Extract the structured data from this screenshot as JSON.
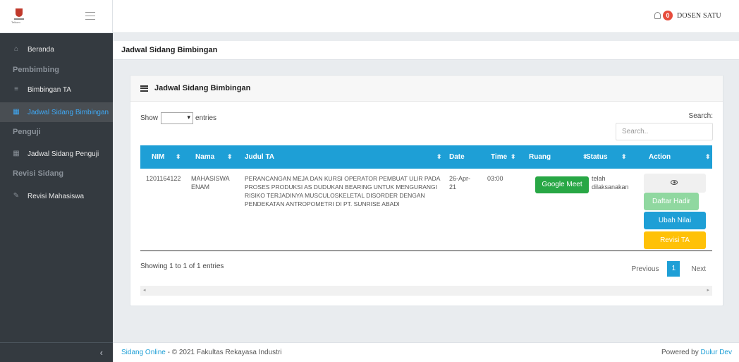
{
  "brand": {
    "logo_text": "Telkom"
  },
  "topbar": {
    "notification_count": "0",
    "user": "DOSEN SATU"
  },
  "sidebar": {
    "beranda": "Beranda",
    "header_pembimbing": "Pembimbing",
    "bimbingan_ta": "Bimbingan TA",
    "jadwal_sidang_bimbingan": "Jadwal Sidang Bimbingan",
    "header_penguji": "Penguji",
    "jadwal_sidang_penguji": "Jadwal Sidang Penguji",
    "header_revisi": "Revisi Sidang",
    "revisi_mahasiswa": "Revisi Mahasiswa"
  },
  "page": {
    "title": "Jadwal Sidang Bimbingan"
  },
  "card": {
    "title": "Jadwal Sidang Bimbingan",
    "show_label": "Show",
    "entries_label": "entries",
    "search_label": "Search:",
    "search_placeholder": "Search..",
    "columns": [
      "NIM",
      "Nama",
      "Judul TA",
      "Date",
      "Time",
      "Ruang",
      "Status",
      "Action"
    ],
    "rows": [
      {
        "nim": "1201164122",
        "nama": "MAHASISWA ENAM",
        "judul": "PERANCANGAN MEJA DAN KURSI OPERATOR PEMBUAT ULIR PADA PROSES PRODUKSI AS DUDUKAN BEARING UNTUK MENGURANGI RISIKO TERJADINYA MUSCULOSKELETAL DISORDER DENGAN PENDEKATAN ANTROPOMETRI DI PT. SUNRISE ABADI",
        "date": "26-Apr-21",
        "time": "03:00",
        "ruang": "Google Meet",
        "status": "telah dilaksanakan",
        "actions": {
          "daftar_hadir": "Daftar Hadir",
          "ubah_nilai": "Ubah Nilai",
          "revisi_ta": "Revisi TA"
        }
      }
    ],
    "info": "Showing 1 to 1 of 1 entries",
    "pager": {
      "previous": "Previous",
      "current": "1",
      "next": "Next"
    }
  },
  "footer": {
    "app_link": "Sidang Online",
    "copyright": " - © 2021 Fakultas Rekayasa Industri",
    "powered_by": "Powered by ",
    "dev_link": "Dulur Dev"
  },
  "colors": {
    "primary": "#1e9fd6",
    "success": "#28a745",
    "warning": "#ffc107",
    "sidebar": "#343a40"
  }
}
